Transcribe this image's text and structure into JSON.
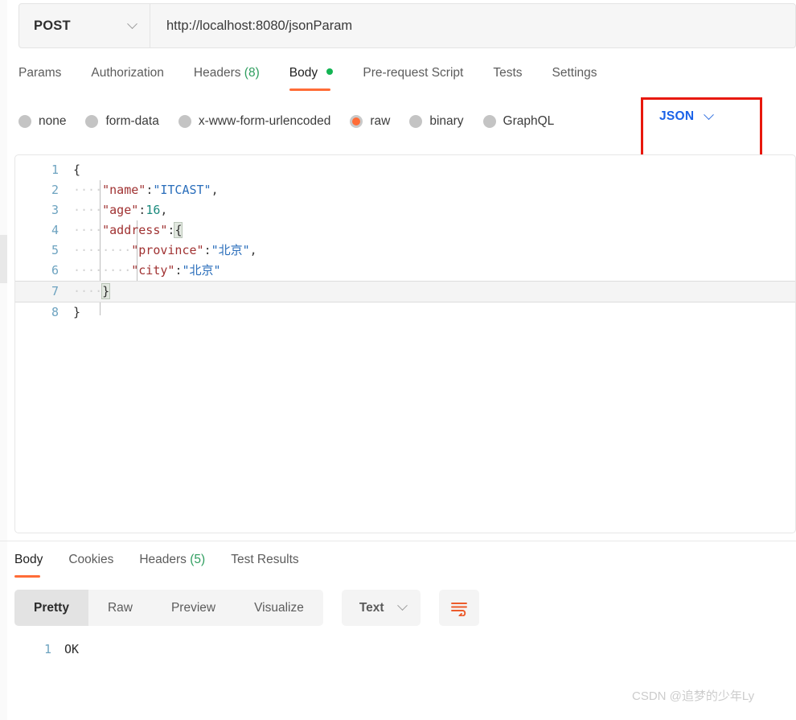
{
  "request": {
    "method": "POST",
    "url": "http://localhost:8080/jsonParam",
    "tabs": [
      {
        "label": "Params",
        "active": false
      },
      {
        "label": "Authorization",
        "active": false
      },
      {
        "label": "Headers",
        "count": "(8)",
        "active": false
      },
      {
        "label": "Body",
        "active": true,
        "dot": true
      },
      {
        "label": "Pre-request Script",
        "active": false
      },
      {
        "label": "Tests",
        "active": false
      },
      {
        "label": "Settings",
        "active": false
      }
    ],
    "body_types": [
      {
        "label": "none",
        "selected": false
      },
      {
        "label": "form-data",
        "selected": false
      },
      {
        "label": "x-www-form-urlencoded",
        "selected": false
      },
      {
        "label": "raw",
        "selected": true
      },
      {
        "label": "binary",
        "selected": false
      },
      {
        "label": "GraphQL",
        "selected": false
      }
    ],
    "raw_format": "JSON",
    "editor": {
      "lines": [
        {
          "num": "1",
          "active": false
        },
        {
          "num": "2",
          "active": false
        },
        {
          "num": "3",
          "active": false
        },
        {
          "num": "4",
          "active": false
        },
        {
          "num": "5",
          "active": false
        },
        {
          "num": "6",
          "active": false
        },
        {
          "num": "7",
          "active": true
        },
        {
          "num": "8",
          "active": false
        }
      ],
      "content": {
        "l1_brace": "{",
        "l2_key": "\"name\"",
        "l2_colon": ":",
        "l2_val": "\"ITCAST\"",
        "l2_comma": ",",
        "l3_key": "\"age\"",
        "l3_colon": ":",
        "l3_val": "16",
        "l3_comma": ",",
        "l4_key": "\"address\"",
        "l4_colon": ":",
        "l4_brace": "{",
        "l5_key": "\"province\"",
        "l5_colon": ":",
        "l5_val": "\"北京\"",
        "l5_comma": ",",
        "l6_key": "\"city\"",
        "l6_colon": ":",
        "l6_val": "\"北京\"",
        "l7_brace": "}",
        "l8_brace": "}",
        "indent4": "····",
        "indent8": "········"
      }
    }
  },
  "response": {
    "tabs": [
      {
        "label": "Body",
        "active": true
      },
      {
        "label": "Cookies",
        "active": false
      },
      {
        "label": "Headers",
        "count": "(5)",
        "active": false
      },
      {
        "label": "Test Results",
        "active": false
      }
    ],
    "view_modes": [
      {
        "label": "Pretty",
        "active": true
      },
      {
        "label": "Raw",
        "active": false
      },
      {
        "label": "Preview",
        "active": false
      },
      {
        "label": "Visualize",
        "active": false
      }
    ],
    "format": "Text",
    "wrap_icon": "word-wrap-icon",
    "body_lines": [
      {
        "num": "1",
        "text": "OK"
      }
    ]
  },
  "watermark": "CSDN @追梦的少年Ly",
  "colors": {
    "accent": "#ff6c37",
    "highlight_box": "#e8180c",
    "json_label": "#1a62e8",
    "status_dot": "#13b453",
    "count": "#2f9e5f"
  }
}
